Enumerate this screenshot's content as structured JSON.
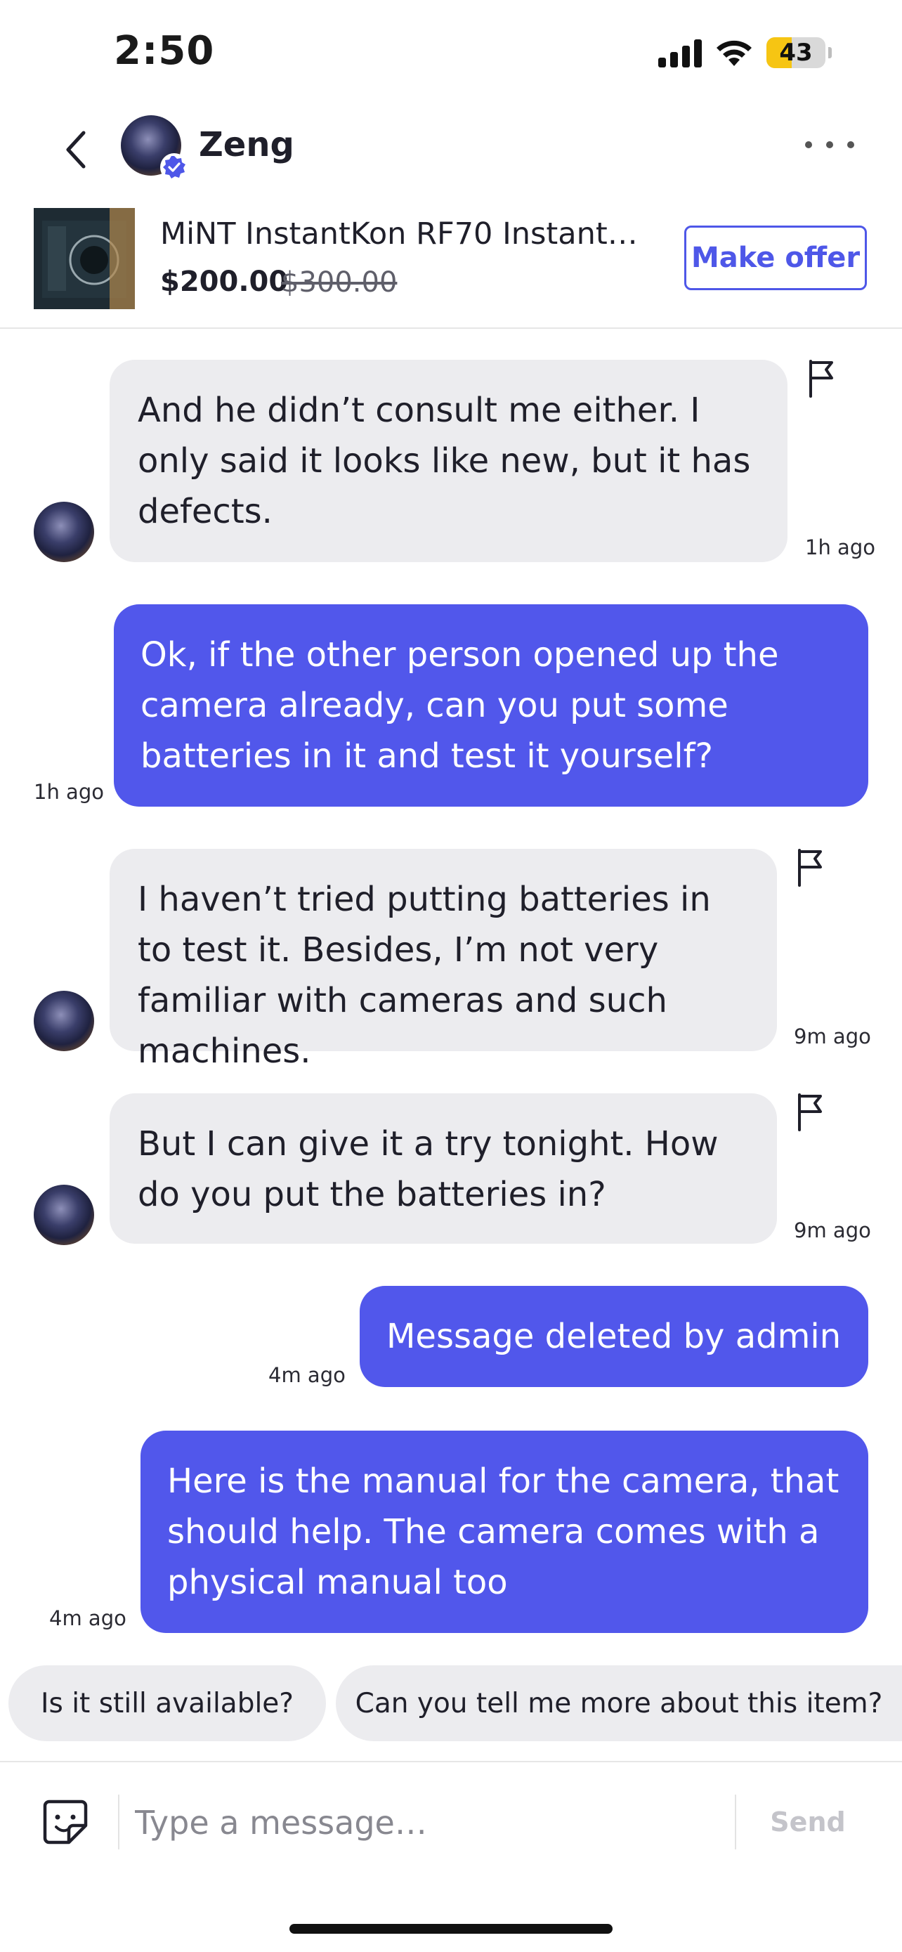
{
  "status_bar": {
    "time": "2:50",
    "battery": "43",
    "battery_level": 0.43,
    "battery_color": "#f6c513"
  },
  "header": {
    "back_icon": "chevron-left-icon",
    "name": "Zeng",
    "verified_icon": "verified-check-icon",
    "more_icon": "more-horizontal-icon"
  },
  "listing": {
    "title": "MiNT InstantKon RF70 Instant…",
    "price": "$200.00",
    "old_price": "$300.00",
    "make_offer_label": "Make offer"
  },
  "messages": [
    {
      "direction": "in",
      "text": "And he didn’t consult me either. I only said it looks like new, but it has defects.",
      "time": "1h ago",
      "flag_icon": "flag-icon"
    },
    {
      "direction": "out",
      "text": "Ok, if the other person opened up the camera already, can you put some batteries in it and test it yourself?",
      "time": "1h ago"
    },
    {
      "direction": "in",
      "text": "I haven’t tried putting batteries in to test it. Besides, I’m not very familiar with cameras and such machines.",
      "time": "9m ago",
      "flag_icon": "flag-icon"
    },
    {
      "direction": "in",
      "text": "But I can give it a try tonight. How do you put the batteries in?",
      "time": "9m ago",
      "flag_icon": "flag-icon"
    },
    {
      "direction": "out",
      "text": "Message deleted by admin",
      "time": "4m ago"
    },
    {
      "direction": "out",
      "text": "Here is the manual for the camera, that should help. The camera comes with a physical manual too",
      "time": "4m ago"
    }
  ],
  "quick_replies": [
    "Is it still available?",
    "Can you tell me more about this item?"
  ],
  "composer": {
    "sticker_icon": "sticker-icon",
    "placeholder": "Type a message…",
    "send_label": "Send"
  },
  "colors": {
    "accent": "#5157eb",
    "incoming_bubble": "#ececef",
    "send_disabled": "#c4c4ca"
  }
}
